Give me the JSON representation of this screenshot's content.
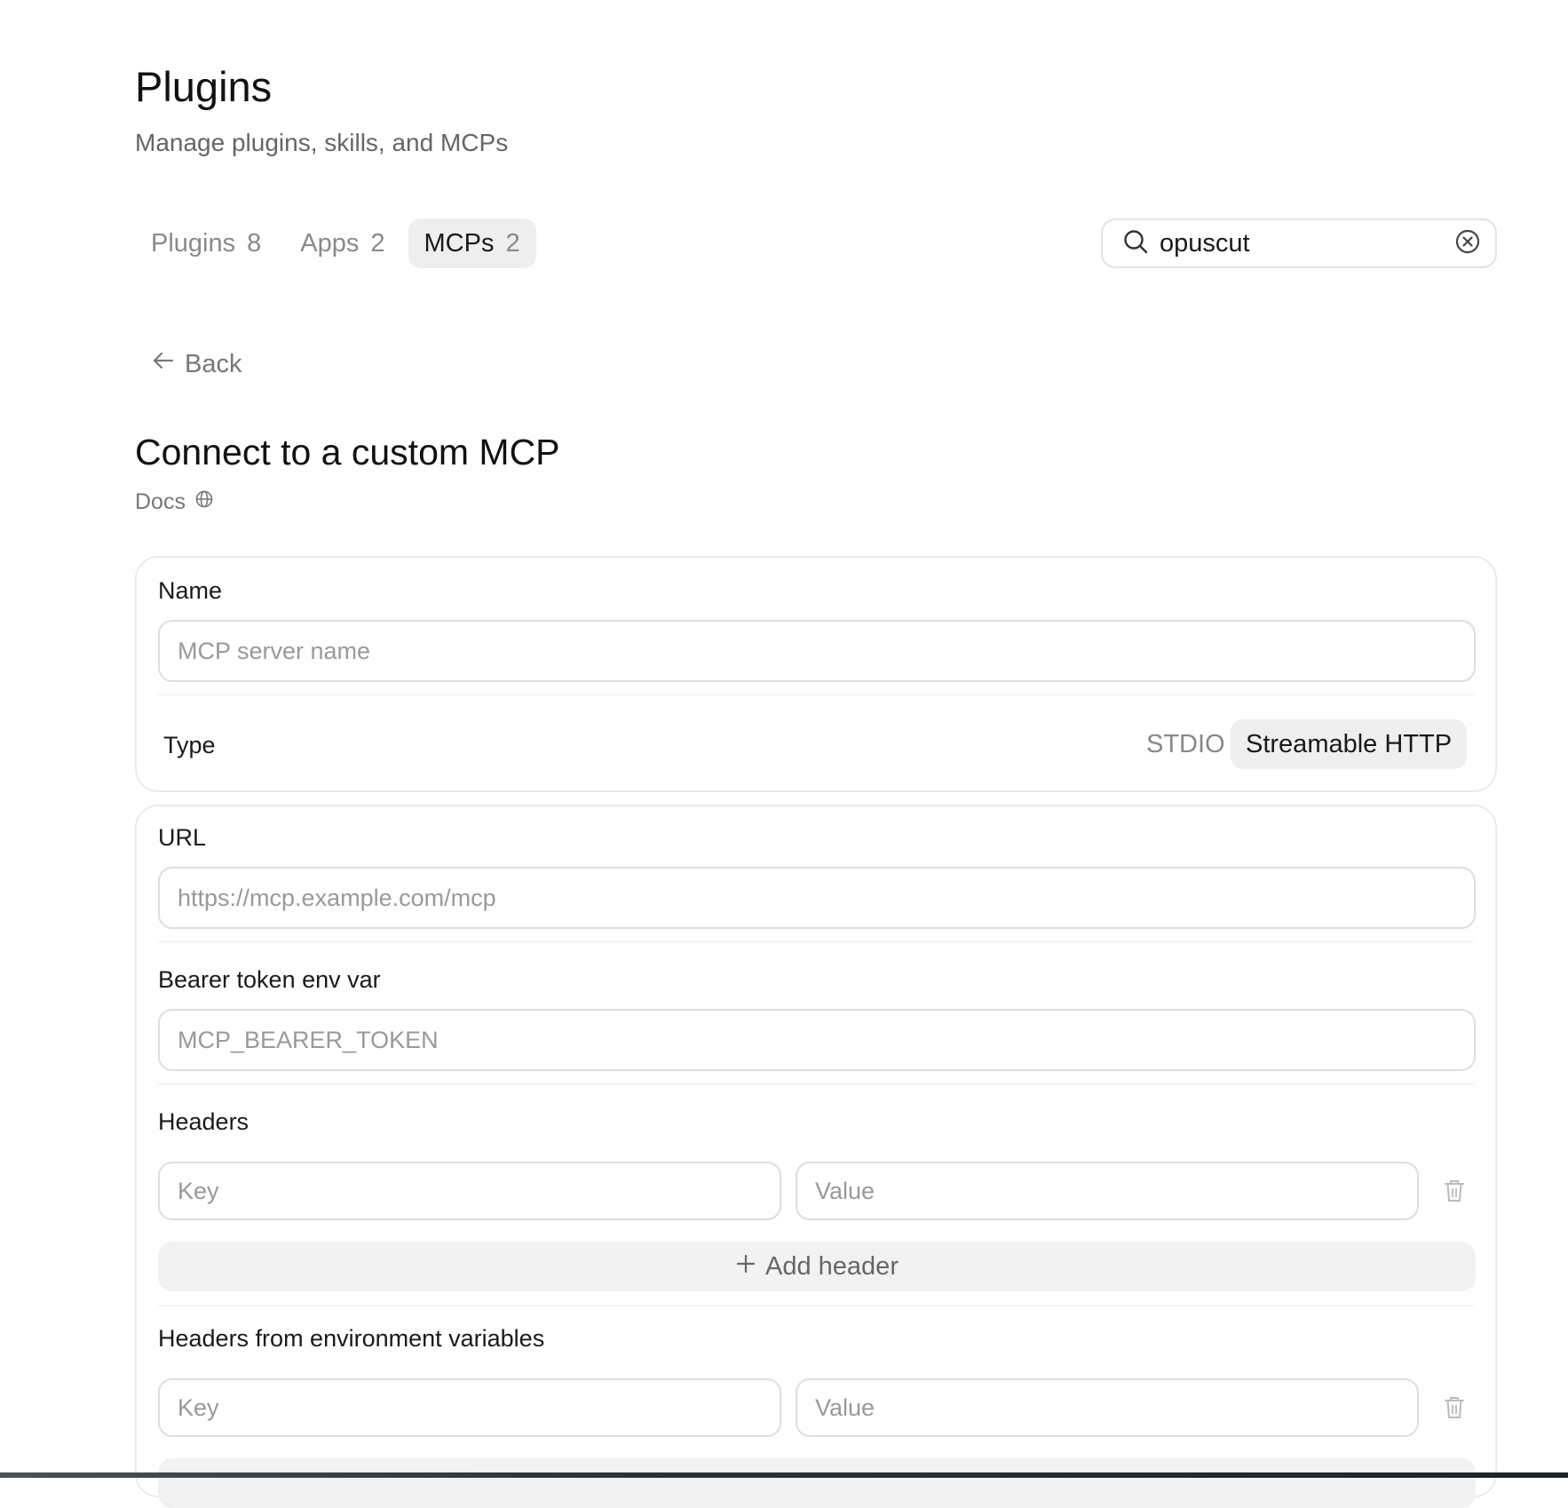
{
  "header": {
    "title": "Plugins",
    "subtitle": "Manage plugins, skills, and MCPs"
  },
  "tabs": [
    {
      "label": "Plugins",
      "count": "8",
      "active": false
    },
    {
      "label": "Apps",
      "count": "2",
      "active": false
    },
    {
      "label": "MCPs",
      "count": "2",
      "active": true
    }
  ],
  "search": {
    "value": "opuscut",
    "icon": "search-icon",
    "clear_icon": "clear-circle-icon"
  },
  "back": {
    "label": "Back",
    "icon": "arrow-left-icon"
  },
  "form": {
    "heading": "Connect to a custom MCP",
    "docs_label": "Docs",
    "docs_icon": "globe-icon",
    "name": {
      "label": "Name",
      "placeholder": "MCP server name"
    },
    "type": {
      "label": "Type",
      "options": [
        "STDIO",
        "Streamable HTTP"
      ],
      "selected": "Streamable HTTP"
    },
    "url": {
      "label": "URL",
      "placeholder": "https://mcp.example.com/mcp"
    },
    "bearer": {
      "label": "Bearer token env var",
      "placeholder": "MCP_BEARER_TOKEN"
    },
    "headers": {
      "label": "Headers",
      "key_placeholder": "Key",
      "value_placeholder": "Value",
      "add_label": "Add header"
    },
    "env_headers": {
      "label": "Headers from environment variables",
      "key_placeholder": "Key",
      "value_placeholder": "Value"
    }
  },
  "colors": {
    "accent_bg": "#eeeeee",
    "border": "#e3e3e3",
    "muted_text": "#888888"
  }
}
